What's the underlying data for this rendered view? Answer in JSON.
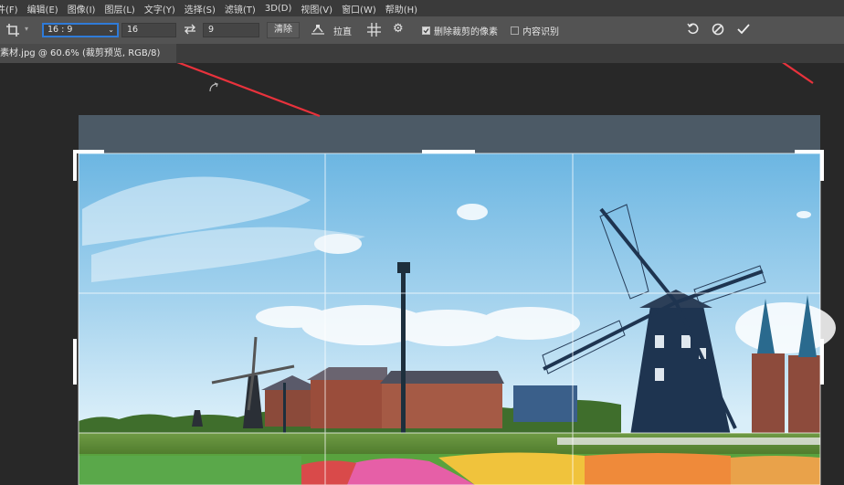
{
  "menu": [
    "件(F)",
    "编辑(E)",
    "图像(I)",
    "图层(L)",
    "文字(Y)",
    "选择(S)",
    "滤镜(T)",
    "3D(D)",
    "视图(V)",
    "窗口(W)",
    "帮助(H)"
  ],
  "options": {
    "ratio_value": "16 : 9",
    "width_value": "16",
    "height_value": "9",
    "clear_label": "清除",
    "straighten_label": "拉直",
    "delete_pixels_label": "删除裁剪的像素",
    "delete_pixels_checked": true,
    "content_aware_label": "内容识别",
    "content_aware_checked": false
  },
  "document_tab": "素材.jpg @ 60.6% (裁剪预览, RGB/8)",
  "icons": {
    "crop_tool": "crop-icon",
    "swap": "swap-icon",
    "straighten": "straighten-icon",
    "overlay": "grid-overlay-icon",
    "settings": "gear-icon",
    "reset": "reset-icon",
    "cancel": "cancel-icon",
    "commit": "checkmark-icon"
  },
  "colors": {
    "annotation_arrow": "#e8323c",
    "selection": "#2f7bd8",
    "toolbar": "#535353",
    "workspace": "#282828"
  }
}
